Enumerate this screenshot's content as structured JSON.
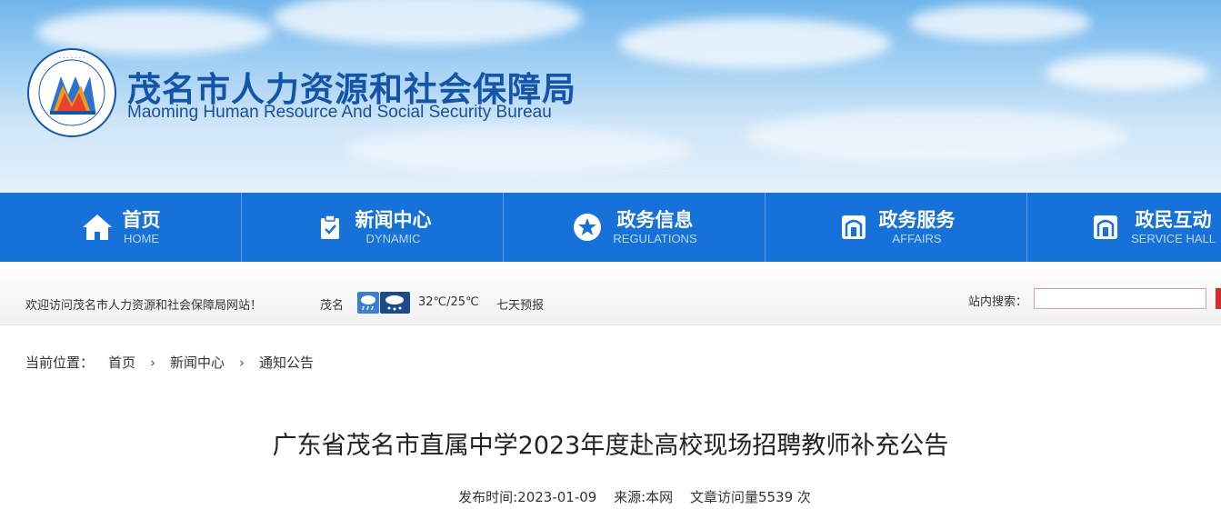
{
  "header": {
    "title_cn": "茂名市人力资源和社会保障局",
    "title_en": "Maoming Human Resource And Social Security Bureau",
    "logo_text": "茂名市人力资源和社会保障局"
  },
  "nav": {
    "items": [
      {
        "cn": "首页",
        "en": "HOME",
        "icon": "home-icon"
      },
      {
        "cn": "新闻中心",
        "en": "DYNAMIC",
        "icon": "clipboard-check-icon"
      },
      {
        "cn": "政务信息",
        "en": "REGULATIONS",
        "icon": "star-icon"
      },
      {
        "cn": "政务服务",
        "en": "AFFAIRS",
        "icon": "building-icon"
      },
      {
        "cn": "政民互动",
        "en": "SERVICE HALL",
        "icon": "building-icon"
      }
    ]
  },
  "infobar": {
    "welcome": "欢迎访问茂名市人力资源和社会保障局网站！",
    "city": "茂名",
    "temperature": "32℃/25℃",
    "forecast": "七天预报",
    "search_label": "站内搜索：",
    "search_value": ""
  },
  "breadcrumb": {
    "prefix": "当前位置：",
    "items": [
      "首页",
      "新闻中心",
      "通知公告"
    ]
  },
  "article": {
    "title": "广东省茂名市直属中学2023年度赴高校现场招聘教师补充公告",
    "publish": "发布时间:2023-01-09",
    "source": "来源:本网",
    "views": "文章访问量5539 次"
  },
  "colors": {
    "nav_bg": "#1672d8",
    "title_blue": "#1455a8"
  }
}
